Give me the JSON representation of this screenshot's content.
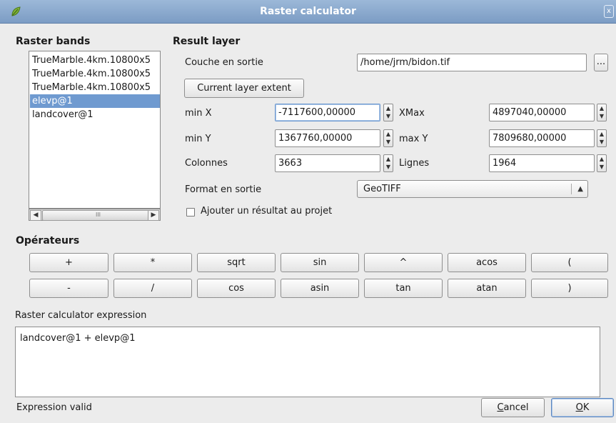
{
  "window": {
    "title": "Raster calculator",
    "close_glyph": "x"
  },
  "raster_bands": {
    "title": "Raster bands",
    "items": [
      "TrueMarble.4km.10800x5",
      "TrueMarble.4km.10800x5",
      "TrueMarble.4km.10800x5",
      "elevp@1",
      "landcover@1"
    ],
    "selected_index": 3,
    "scroll_thumb_glyph": "III"
  },
  "result_layer": {
    "title": "Result layer",
    "output_label": "Couche en sortie",
    "output_path": "/home/jrm/bidon.tif",
    "browse_label": "...",
    "extent_button": "Current layer extent",
    "min_x_label": "min X",
    "min_x": "-7117600,00000",
    "xmax_label": "XMax",
    "xmax": "4897040,00000",
    "min_y_label": "min Y",
    "min_y": "1367760,00000",
    "max_y_label": "max Y",
    "max_y": "7809680,00000",
    "columns_label": "Colonnes",
    "columns": "3663",
    "rows_label": "Lignes",
    "rows": "1964",
    "format_label": "Format en sortie",
    "format_value": "GeoTIFF",
    "add_to_project_label": "Ajouter un résultat au projet",
    "add_to_project_checked": false
  },
  "operators": {
    "title": "Opérateurs",
    "row1": [
      "+",
      "*",
      "sqrt",
      "sin",
      "^",
      "acos",
      "("
    ],
    "row2": [
      "-",
      "/",
      "cos",
      "asin",
      "tan",
      "atan",
      ")"
    ]
  },
  "expression": {
    "label": "Raster calculator expression",
    "value": "landcover@1 + elevp@1",
    "status": "Expression valid"
  },
  "buttons": {
    "cancel_first": "C",
    "cancel_rest": "ancel",
    "ok_first": "O",
    "ok_rest": "K"
  }
}
